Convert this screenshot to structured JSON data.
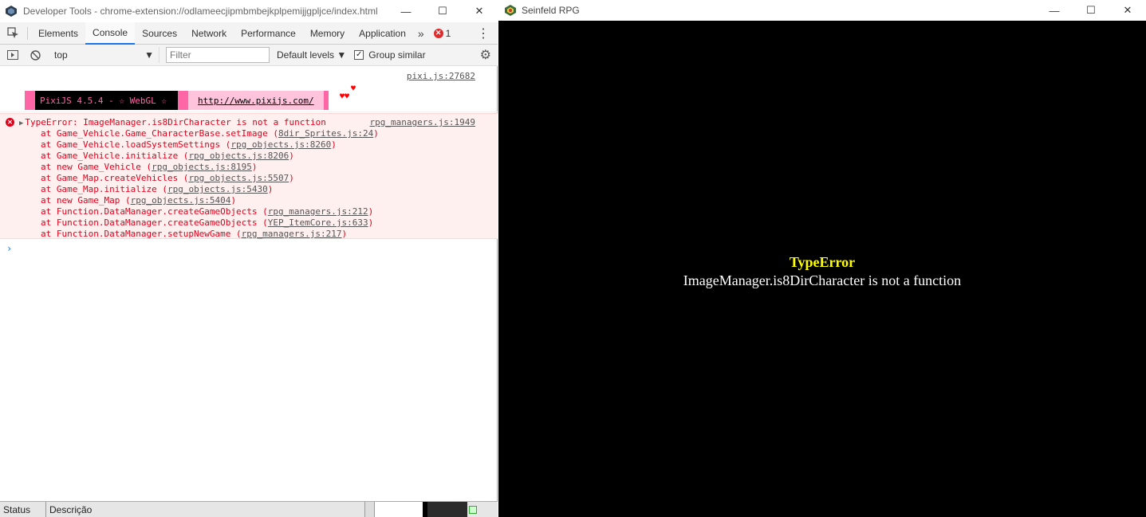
{
  "devtools": {
    "title": "Developer Tools - chrome-extension://odlameecjipmbmbejkplpemijjgpljce/index.html",
    "window_buttons": {
      "minimize": "—",
      "maximize": "☐",
      "close": "✕"
    },
    "tabs": [
      "Elements",
      "Console",
      "Sources",
      "Network",
      "Performance",
      "Memory",
      "Application"
    ],
    "active_tab": "Console",
    "more_tabs": "»",
    "error_count": "1",
    "toolbar": {
      "context": "top",
      "filter_placeholder": "Filter",
      "levels": "Default levels ▼",
      "group_similar_checked": true,
      "group_similar_label": "Group similar"
    },
    "console": {
      "log_source": "pixi.js:27682",
      "pixi_banner": "PixiJS 4.5.4 - ☆ WebGL ☆",
      "pixi_url": "http://www.pixijs.com/",
      "hearts_top": "♥",
      "hearts_bottom": "♥♥",
      "error": {
        "message": "TypeError: ImageManager.is8DirCharacter is not a function",
        "source": "rpg_managers.js:1949",
        "stack": [
          {
            "text": "at Game_Vehicle.Game_CharacterBase.setImage (",
            "link": "8dir_Sprites.js:24",
            "end": ")"
          },
          {
            "text": "at Game_Vehicle.loadSystemSettings (",
            "link": "rpg_objects.js:8260",
            "end": ")"
          },
          {
            "text": "at Game_Vehicle.initialize (",
            "link": "rpg_objects.js:8206",
            "end": ")"
          },
          {
            "text": "at new Game_Vehicle (",
            "link": "rpg_objects.js:8195",
            "end": ")"
          },
          {
            "text": "at Game_Map.createVehicles (",
            "link": "rpg_objects.js:5507",
            "end": ")"
          },
          {
            "text": "at Game_Map.initialize (",
            "link": "rpg_objects.js:5430",
            "end": ")"
          },
          {
            "text": "at new Game_Map (",
            "link": "rpg_objects.js:5404",
            "end": ")"
          },
          {
            "text": "at Function.DataManager.createGameObjects (",
            "link": "rpg_managers.js:212",
            "end": ")"
          },
          {
            "text": "at Function.DataManager.createGameObjects (",
            "link": "YEP_ItemCore.js:633",
            "end": ")"
          },
          {
            "text": "at Function.DataManager.setupNewGame (",
            "link": "rpg_managers.js:217",
            "end": ")"
          }
        ]
      },
      "prompt": "›"
    }
  },
  "taskbar": {
    "status_label": "Status",
    "description_label": "Descrição"
  },
  "game": {
    "title": "Seinfeld RPG",
    "window_buttons": {
      "minimize": "—",
      "maximize": "☐",
      "close": "✕"
    },
    "error_name": "TypeError",
    "error_message": "ImageManager.is8DirCharacter is not a function"
  },
  "colors": {
    "error_red": "#e0001a",
    "pixi_pink": "#ff66a5",
    "game_error_yellow": "#ffff00",
    "active_tab_accent": "#1a73e8"
  }
}
